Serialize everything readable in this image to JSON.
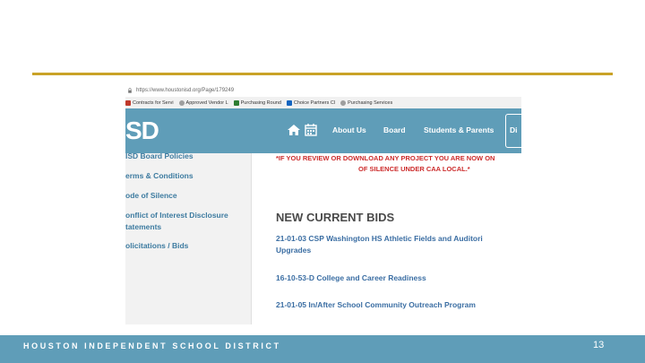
{
  "browser": {
    "url": "https://www.houstonisd.org/Page/179249",
    "bookmarks": [
      {
        "label": "Contracts for Servi",
        "icon": "bookmark-icon",
        "color": "#c0392b"
      },
      {
        "label": "Approved Vendor L",
        "icon": "globe-icon",
        "color": "#9e9e9e"
      },
      {
        "label": "Purchasing Round",
        "icon": "page-icon",
        "color": "#2e7d32"
      },
      {
        "label": "Choice Partners Cl",
        "icon": "cp-icon",
        "color": "#1565c0"
      },
      {
        "label": "Purchasing Services",
        "icon": "globe-icon",
        "color": "#9e9e9e"
      }
    ]
  },
  "site": {
    "logo": "SD",
    "nav": [
      "About Us",
      "Board",
      "Students & Parents",
      "Di"
    ]
  },
  "sidebar": {
    "items": [
      "ISD Board Policies",
      "erms & Conditions",
      "ode of Silence",
      "onflict of Interest Disclosure",
      "tatements",
      "olicitations / Bids"
    ]
  },
  "main": {
    "warning_line1": "*IF YOU REVIEW OR DOWNLOAD ANY PROJECT YOU ARE NOW ON",
    "warning_line2": "OF SILENCE UNDER CAA LOCAL.*",
    "heading": "NEW CURRENT BIDS",
    "bids": [
      "21-01-03 CSP Washington HS Athletic Fields and Auditori",
      "Upgrades",
      "16-10-53-D College and Career Readiness",
      "21-01-05 In/After School Community Outreach Program"
    ]
  },
  "footer": {
    "text": "HOUSTON INDEPENDENT SCHOOL DISTRICT",
    "page_number": "13"
  },
  "colors": {
    "accent_gold": "#c9a227",
    "brand_blue": "#5f9db8",
    "link_blue": "#3b6ea3",
    "warning_red": "#cc2b2b"
  }
}
